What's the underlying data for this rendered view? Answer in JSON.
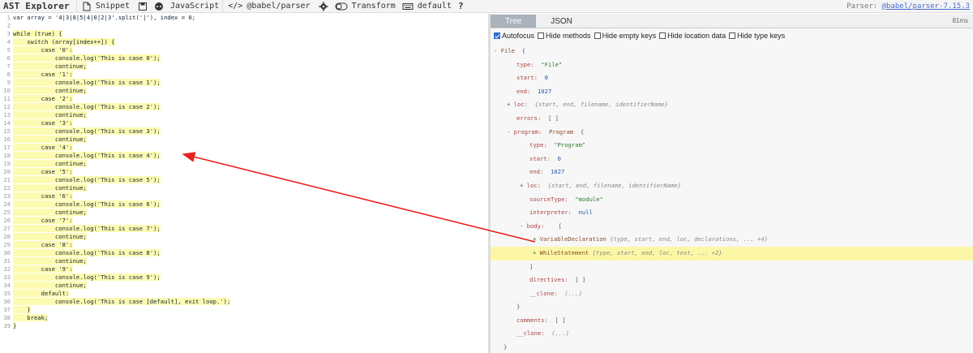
{
  "toolbar": {
    "title": "AST Explorer",
    "snippet": "Snippet",
    "language": "JavaScript",
    "parser": "@babel/parser",
    "transform": "Transform",
    "keymap": "default",
    "help": "?",
    "parser_label": "Parser:",
    "parser_version": "@babel/parser-7.15.3"
  },
  "editor": {
    "lines": [
      {
        "n": "1",
        "text": "var array = '4|3|8|5|4|0|2|3'.split('|'), index = 0;",
        "hl": false
      },
      {
        "n": "2",
        "text": "",
        "hl": false
      },
      {
        "n": "3",
        "text": "while (true) {",
        "hl": true
      },
      {
        "n": "4",
        "text": "    switch (array[index++]) {",
        "hl": true
      },
      {
        "n": "5",
        "text": "        case '0':",
        "hl": true
      },
      {
        "n": "6",
        "text": "            console.log('This is case 0');",
        "hl": true
      },
      {
        "n": "7",
        "text": "            continue;",
        "hl": true
      },
      {
        "n": "8",
        "text": "        case '1':",
        "hl": true
      },
      {
        "n": "9",
        "text": "            console.log('This is case 1');",
        "hl": true
      },
      {
        "n": "10",
        "text": "            continue;",
        "hl": true
      },
      {
        "n": "11",
        "text": "        case '2':",
        "hl": true
      },
      {
        "n": "12",
        "text": "            console.log('This is case 2');",
        "hl": true
      },
      {
        "n": "13",
        "text": "            continue;",
        "hl": true
      },
      {
        "n": "14",
        "text": "        case '3':",
        "hl": true
      },
      {
        "n": "15",
        "text": "            console.log('This is case 3');",
        "hl": true
      },
      {
        "n": "16",
        "text": "            continue;",
        "hl": true
      },
      {
        "n": "17",
        "text": "        case '4':",
        "hl": true
      },
      {
        "n": "18",
        "text": "            console.log('This is case 4');",
        "hl": true
      },
      {
        "n": "19",
        "text": "            continue;",
        "hl": true
      },
      {
        "n": "20",
        "text": "        case '5':",
        "hl": true
      },
      {
        "n": "21",
        "text": "            console.log('This is case 5');",
        "hl": true
      },
      {
        "n": "22",
        "text": "            continue;",
        "hl": true
      },
      {
        "n": "23",
        "text": "        case '6':",
        "hl": true
      },
      {
        "n": "24",
        "text": "            console.log('This is case 6');",
        "hl": true
      },
      {
        "n": "25",
        "text": "            continue;",
        "hl": true
      },
      {
        "n": "26",
        "text": "        case '7':",
        "hl": true
      },
      {
        "n": "27",
        "text": "            console.log('This is case 7');",
        "hl": true
      },
      {
        "n": "28",
        "text": "            continue;",
        "hl": true
      },
      {
        "n": "29",
        "text": "        case '8':",
        "hl": true
      },
      {
        "n": "30",
        "text": "            console.log('This is case 8');",
        "hl": true
      },
      {
        "n": "31",
        "text": "            continue;",
        "hl": true
      },
      {
        "n": "32",
        "text": "        case '9':",
        "hl": true
      },
      {
        "n": "33",
        "text": "            console.log('This is case 9');",
        "hl": true
      },
      {
        "n": "34",
        "text": "            continue;",
        "hl": true
      },
      {
        "n": "35",
        "text": "        default:",
        "hl": true
      },
      {
        "n": "36",
        "text": "            console.log('This is case [default], exit loop.');",
        "hl": true
      },
      {
        "n": "37",
        "text": "    }",
        "hl": true
      },
      {
        "n": "38",
        "text": "    break;",
        "hl": true
      },
      {
        "n": "39",
        "text": "}",
        "hl": true
      }
    ]
  },
  "panel": {
    "tabs": [
      "Tree",
      "JSON"
    ],
    "active_tab": "Tree",
    "time": "81ms",
    "options": [
      {
        "label": "Autofocus",
        "checked": true
      },
      {
        "label": "Hide methods",
        "checked": false
      },
      {
        "label": "Hide empty keys",
        "checked": false
      },
      {
        "label": "Hide location data",
        "checked": false
      },
      {
        "label": "Hide type keys",
        "checked": false
      }
    ]
  },
  "tree": {
    "file": {
      "toggle": "-",
      "key": "File",
      "brace": "{"
    },
    "file_type": {
      "key": "type:",
      "value": "\"File\""
    },
    "file_start": {
      "key": "start:",
      "value": "0"
    },
    "file_end": {
      "key": "end:",
      "value": "1027"
    },
    "file_loc": {
      "toggle": "+",
      "key": "loc:",
      "value": "{start, end, filename, identifierName}"
    },
    "file_errors": {
      "key": "errors:",
      "value": "[ ]"
    },
    "program": {
      "toggle": "-",
      "key": "program:",
      "type": "Program",
      "brace": "{"
    },
    "prog_type": {
      "key": "type:",
      "value": "\"Program\""
    },
    "prog_start": {
      "key": "start:",
      "value": "0"
    },
    "prog_end": {
      "key": "end:",
      "value": "1027"
    },
    "prog_loc": {
      "toggle": "+",
      "key": "loc:",
      "value": "{start, end, filename, identifierName}"
    },
    "prog_source": {
      "key": "sourceType:",
      "value": "\"module\""
    },
    "prog_interp": {
      "key": "interpreter:",
      "value": "null"
    },
    "prog_body": {
      "toggle": "-",
      "key": "body:",
      "brace": "["
    },
    "body_var": {
      "toggle": "+",
      "key": "VariableDeclaration",
      "value": "{type, start, end, loc, declarations, ... +4}"
    },
    "body_while": {
      "toggle": "+",
      "key": "WhileStatement",
      "value": "{type, start, end, loc, test, ... +2}"
    },
    "body_close": "]",
    "prog_directives": {
      "key": "directives:",
      "value": "[ ]"
    },
    "prog_clone": {
      "key": "__clone:",
      "value": "(...)"
    },
    "prog_close": "}",
    "file_comments": {
      "key": "comments:",
      "value": "[ ]"
    },
    "file_clone": {
      "key": "__clone:",
      "value": "(...)"
    },
    "file_close": "}"
  }
}
